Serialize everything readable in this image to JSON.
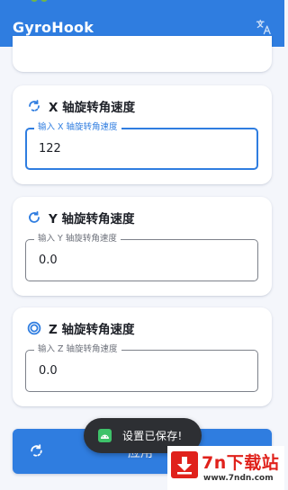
{
  "app": {
    "title": "GyroHook",
    "translate_icon": "translate-icon",
    "accent_color": "#2f7de0"
  },
  "x_axis": {
    "title": "X 轴旋转角速度",
    "field_label": "输入 X 轴旋转角速度",
    "value": "122",
    "icon": "rotate-partial-icon"
  },
  "y_axis": {
    "title": "Y 轴旋转角速度",
    "field_label": "输入 Y 轴旋转角速度",
    "value": "0.0",
    "icon": "rotate-dotted-icon"
  },
  "z_axis": {
    "title": "Z 轴旋转角速度",
    "field_label": "输入 Z 轴旋转角速度",
    "value": "0.0",
    "icon": "target-ring-icon"
  },
  "apply_button": {
    "label": "应用",
    "icon": "rotate-icon"
  },
  "toast": {
    "message": "设置已保存!",
    "icon": "android-icon",
    "icon_color": "#3ec26a"
  },
  "watermark": {
    "name": "7n下载站",
    "url": "www.7ndn.com",
    "color": "#e0211b"
  }
}
